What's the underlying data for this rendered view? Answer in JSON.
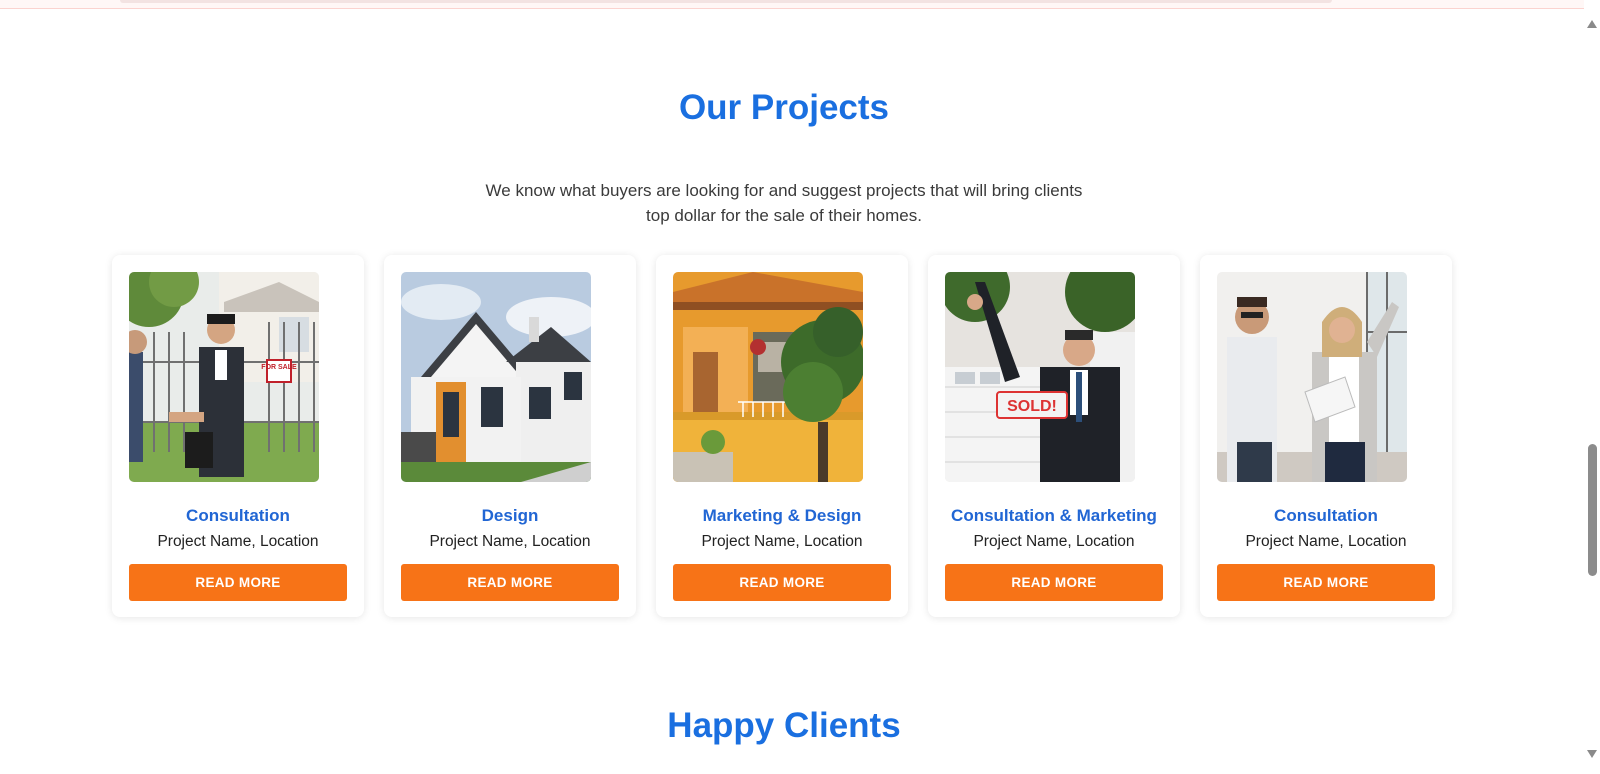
{
  "projects": {
    "title": "Our Projects",
    "intro": "We know what buyers are looking for and suggest projects that will bring clients top dollar for the sale of their homes.",
    "cards": [
      {
        "category": "Consultation",
        "subtitle": "Project Name, Location",
        "button": "READ MORE",
        "image": "agents-handshake-for-sale-gate",
        "sign_text": "FOR SALE"
      },
      {
        "category": "Design",
        "subtitle": "Project Name, Location",
        "button": "READ MORE",
        "image": "modern-white-house"
      },
      {
        "category": "Marketing & Design",
        "subtitle": "Project Name, Location",
        "button": "READ MORE",
        "image": "orange-house-porch"
      },
      {
        "category": "Consultation & Marketing",
        "subtitle": "Project Name, Location",
        "button": "READ MORE",
        "image": "agent-holding-sold-sign",
        "sign_text": "SOLD!"
      },
      {
        "category": "Consultation",
        "subtitle": "Project Name, Location",
        "button": "READ MORE",
        "image": "agents-discussing-indoors"
      }
    ]
  },
  "clients": {
    "title": "Happy Clients"
  },
  "colors": {
    "accent_blue": "#1a6fe0",
    "button_orange": "#f77317"
  }
}
